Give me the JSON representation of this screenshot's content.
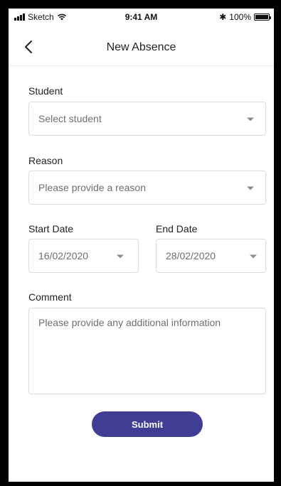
{
  "status_bar": {
    "carrier": "Sketch",
    "time": "9:41 AM",
    "battery": "100%"
  },
  "nav": {
    "title": "New Absence",
    "back_icon": "chevron-left-icon"
  },
  "form": {
    "student": {
      "label": "Student",
      "placeholder": "Select student"
    },
    "reason": {
      "label": "Reason",
      "placeholder": "Please provide a reason"
    },
    "start_date": {
      "label": "Start Date",
      "value": "16/02/2020"
    },
    "end_date": {
      "label": "End Date",
      "value": "28/02/2020"
    },
    "comment": {
      "label": "Comment",
      "placeholder": "Please provide any additional information"
    },
    "submit_label": "Submit"
  },
  "colors": {
    "accent": "#3f3d94",
    "border": "#dcdcdc",
    "placeholder": "#6f6f6f"
  }
}
